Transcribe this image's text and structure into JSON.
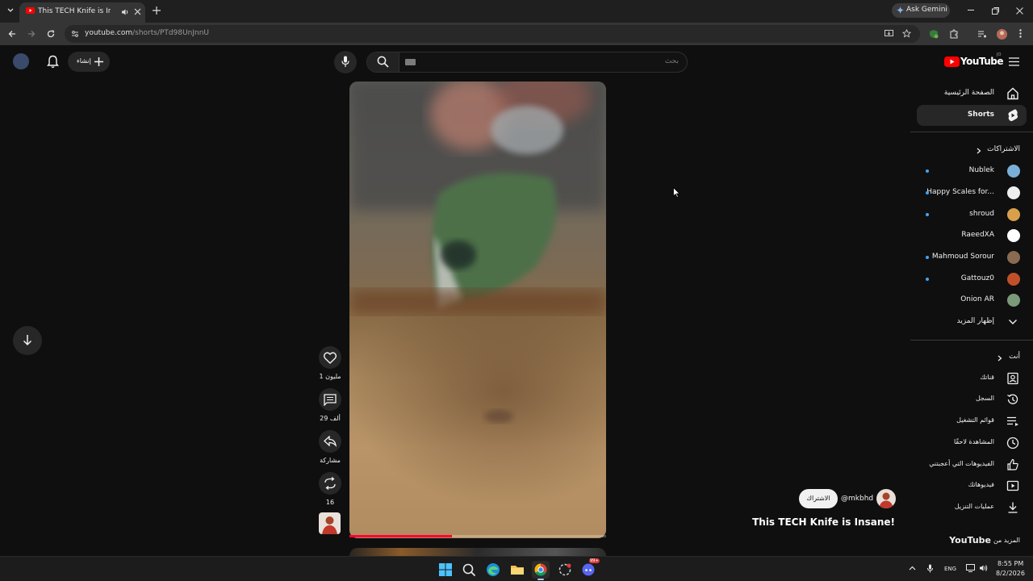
{
  "browser": {
    "tab_title": "This TECH Knife is Insane! -",
    "ask_gemini": "Ask Gemini",
    "url_host": "youtube.com",
    "url_path": "/shorts/PTd98UnJnnU"
  },
  "header": {
    "logo_text": "YouTube",
    "country_code": "JO",
    "search_placeholder": "بحث",
    "create_label": "إنشاء"
  },
  "guide": {
    "home": "الصفحة الرئيسية",
    "shorts": "Shorts",
    "subscriptions_header": "الاشتراكات",
    "subscriptions": [
      {
        "name": "Nublek",
        "new": true,
        "color": "#7ab0d8"
      },
      {
        "name": "Happy Scales for...",
        "new": true,
        "color": "#eeeeee"
      },
      {
        "name": "shroud",
        "new": true,
        "color": "#d8a04a"
      },
      {
        "name": "RaeedXA",
        "new": false,
        "color": "#ffffff"
      },
      {
        "name": "Mahmoud Sorour",
        "new": true,
        "color": "#8a6a50"
      },
      {
        "name": "Gattouz0",
        "new": true,
        "color": "#c0502a"
      },
      {
        "name": "Onion AR",
        "new": false,
        "color": "#7a9a7a"
      }
    ],
    "show_more": "إظهار المزيد",
    "you_header": "أنت",
    "you_items": [
      {
        "label": "قناتك",
        "icon": "channel-icon"
      },
      {
        "label": "السجل",
        "icon": "history-icon"
      },
      {
        "label": "قوائم التشغيل",
        "icon": "playlists-icon"
      },
      {
        "label": "المشاهدة لاحقًا",
        "icon": "watch-later-icon"
      },
      {
        "label": "الفيديوهات التي أعجبتني",
        "icon": "liked-icon"
      },
      {
        "label": "فيديوهاتك",
        "icon": "your-videos-icon"
      },
      {
        "label": "عمليات التنزيل",
        "icon": "downloads-icon"
      }
    ],
    "more_from": "المزيد من",
    "more_from_brand": "YouTube"
  },
  "short": {
    "likes": "1 مليون",
    "comments": "29 ألف",
    "share": "مشاركة",
    "remix_count": "16",
    "progress": 0.4,
    "channel_handle": "@mkbhd",
    "subscribe": "الاشتراك",
    "title": "This TECH Knife is Insane!"
  },
  "taskbar": {
    "lang": "ENG",
    "time": "8:55 PM",
    "date": "8/2/2026",
    "discord_badge": "99+"
  },
  "colors": {
    "accent_red": "#ff0033",
    "link_blue": "#3ea6ff"
  }
}
